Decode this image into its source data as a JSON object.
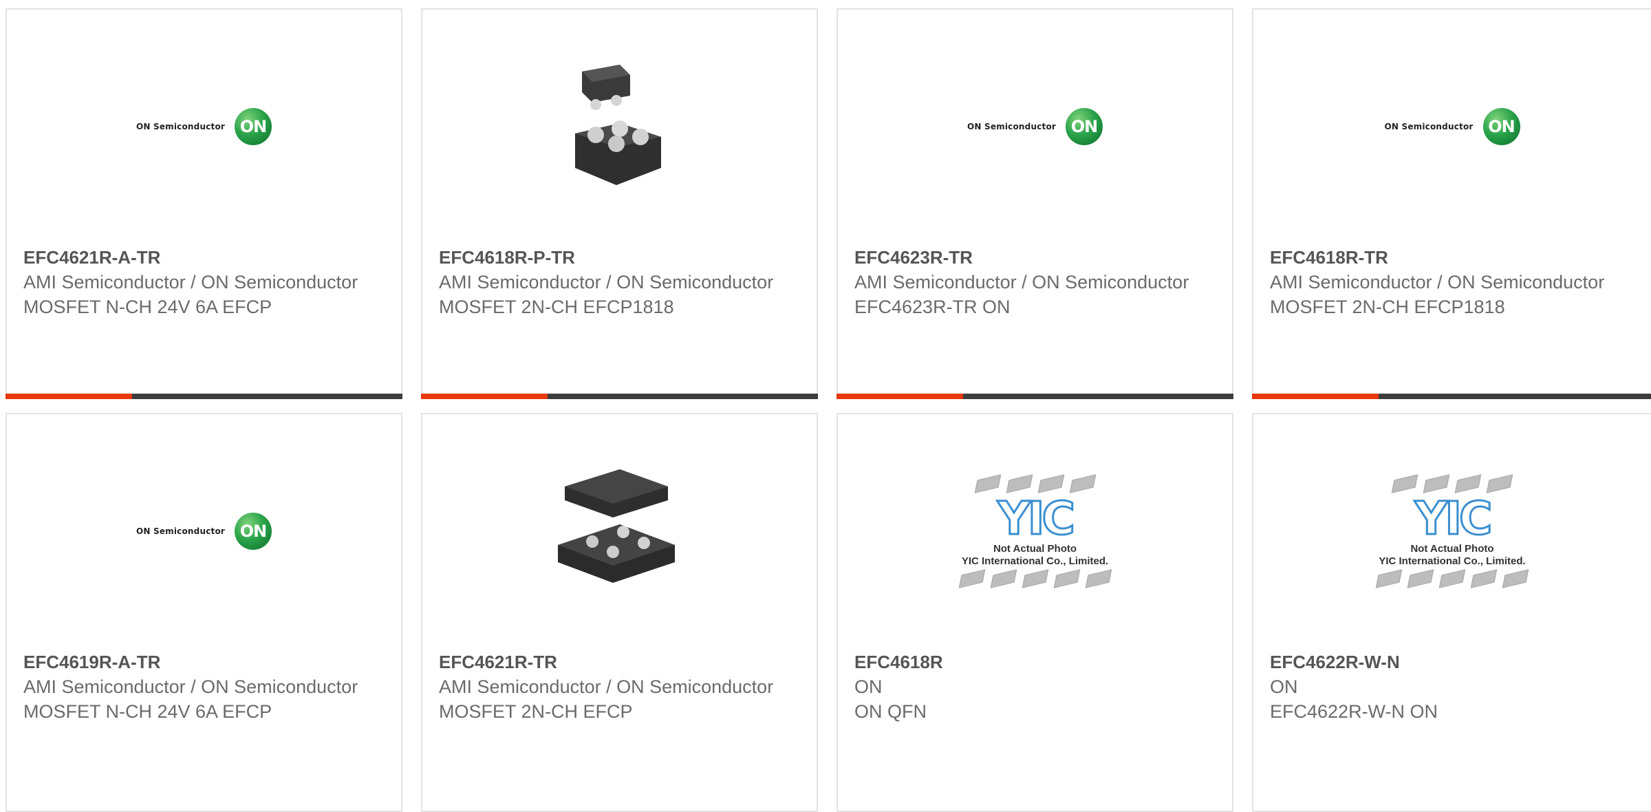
{
  "colors": {
    "accent": "#e8380d",
    "bar": "#3d3d3d",
    "border": "#e3e3e3"
  },
  "logos": {
    "on_semi_text": "ON Semiconductor",
    "on_badge": "ON",
    "yic_mark": "YIC",
    "yic_line1": "Not Actual Photo",
    "yic_line2": "YIC International Co., Limited."
  },
  "cards": [
    {
      "part_number": "EFC4621R-A-TR",
      "manufacturer": "AMI Semiconductor / ON Semiconductor",
      "description": "MOSFET N-CH 24V 6A EFCP",
      "image": "on-semiconductor-logo"
    },
    {
      "part_number": "EFC4618R-P-TR",
      "manufacturer": "AMI Semiconductor / ON Semiconductor",
      "description": "MOSFET 2N-CH EFCP1818",
      "image": "chip-package-exploded"
    },
    {
      "part_number": "EFC4623R-TR",
      "manufacturer": "AMI Semiconductor / ON Semiconductor",
      "description": "EFC4623R-TR ON",
      "image": "on-semiconductor-logo"
    },
    {
      "part_number": "EFC4618R-TR",
      "manufacturer": "AMI Semiconductor / ON Semiconductor",
      "description": "MOSFET 2N-CH EFCP1818",
      "image": "on-semiconductor-logo"
    },
    {
      "part_number": "EFC4619R-A-TR",
      "manufacturer": "AMI Semiconductor / ON Semiconductor",
      "description": "MOSFET N-CH 24V 6A EFCP",
      "image": "on-semiconductor-logo"
    },
    {
      "part_number": "EFC4621R-TR",
      "manufacturer": "AMI Semiconductor / ON Semiconductor",
      "description": "MOSFET 2N-CH EFCP",
      "image": "chip-package-flat"
    },
    {
      "part_number": "EFC4618R",
      "manufacturer": "ON",
      "description": "ON QFN",
      "image": "yic-not-actual-photo"
    },
    {
      "part_number": "EFC4622R-W-N",
      "manufacturer": "ON",
      "description": "EFC4622R-W-N ON",
      "image": "yic-not-actual-photo"
    }
  ]
}
